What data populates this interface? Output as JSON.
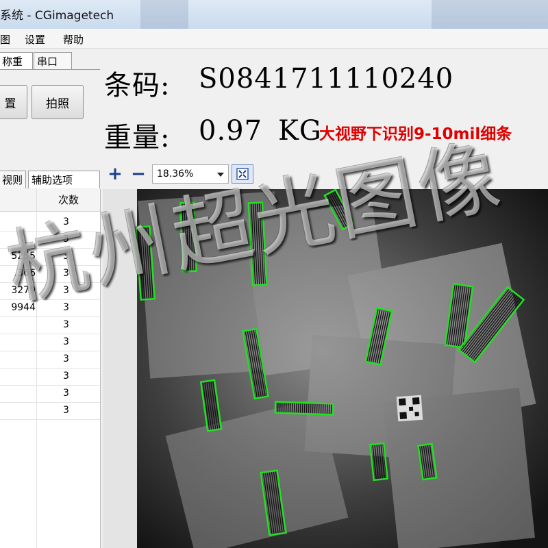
{
  "window": {
    "title": "系统 - CGimagetech"
  },
  "menu": {
    "items": [
      "图",
      "设置",
      "帮助"
    ]
  },
  "top_tabs": [
    "称重",
    "串口"
  ],
  "buttons": {
    "settings_partial": "置",
    "capture": "拍照"
  },
  "result": {
    "barcode_label": "条码:",
    "barcode_value": "S0841711110240",
    "weight_label": "重量:",
    "weight_value": "0.97",
    "weight_unit": "KG",
    "note": "大视野下识别9-10mil细条"
  },
  "view_toolbar": {
    "zoom_in": "+",
    "zoom_out": "−",
    "zoom_value": "18.36%"
  },
  "side_tabs": [
    "视则",
    "辅助选项"
  ],
  "table": {
    "count_header": "次数",
    "rows": [
      {
        "code": "",
        "count": "3"
      },
      {
        "code": "",
        "count": "3"
      },
      {
        "code": "5255",
        "count": "3"
      },
      {
        "code": ".366",
        "count": "3"
      },
      {
        "code": "3279",
        "count": "3"
      },
      {
        "code": "9944",
        "count": "3"
      },
      {
        "code": "",
        "count": "3"
      },
      {
        "code": "",
        "count": "3"
      },
      {
        "code": "",
        "count": "3"
      },
      {
        "code": "",
        "count": "3"
      },
      {
        "code": "",
        "count": "3"
      },
      {
        "code": "",
        "count": "3"
      }
    ]
  },
  "watermark": {
    "text": "杭州超光图像"
  },
  "colors": {
    "accent_note": "#e00000",
    "detection_box": "#22e022",
    "image_bg": "#2a2a2a"
  }
}
